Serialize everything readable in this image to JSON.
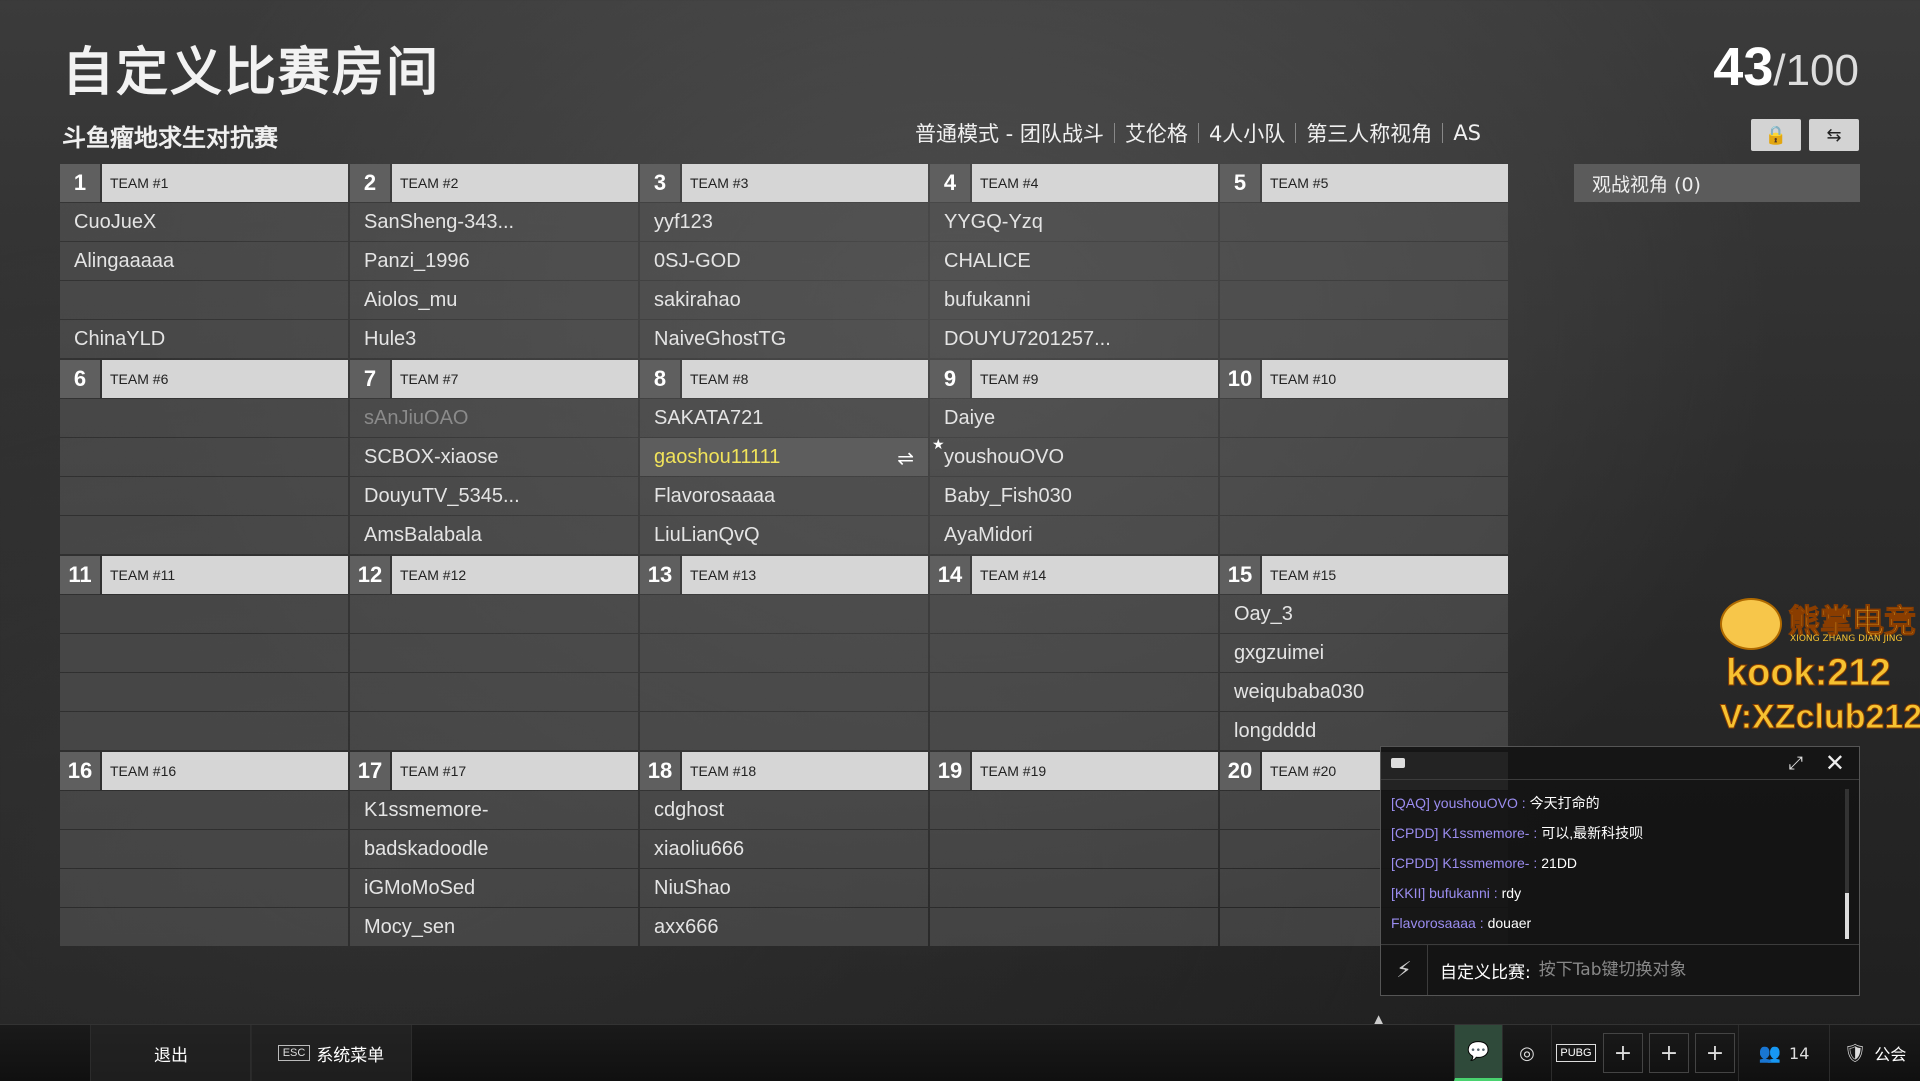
{
  "header": {
    "title": "自定义比赛房间",
    "player_count": "43",
    "player_total": "/100",
    "subtitle": "斗鱼瘤地求生对抗赛",
    "modes": [
      "普通模式 - 团队战斗",
      "艾伦格",
      "4人小队",
      "第三人称视角",
      "AS"
    ],
    "observer": "观战视角 (0)"
  },
  "teams": [
    {
      "num": "1",
      "name": "TEAM #1",
      "players": [
        "CuoJueX",
        "Alingaaaaa",
        "",
        "ChinaYLD"
      ]
    },
    {
      "num": "2",
      "name": "TEAM #2",
      "players": [
        "SanSheng-343...",
        "Panzi_1996",
        "Aiolos_mu",
        "Hule3"
      ]
    },
    {
      "num": "3",
      "name": "TEAM #3",
      "players": [
        "yyf123",
        "0SJ-GOD",
        "sakirahao",
        "NaiveGhostTG"
      ]
    },
    {
      "num": "4",
      "name": "TEAM #4",
      "players": [
        "YYGQ-Yzq",
        "CHALICE",
        "bufukanni",
        "DOUYU7201257..."
      ]
    },
    {
      "num": "5",
      "name": "TEAM #5",
      "players": [
        "",
        "",
        "",
        ""
      ]
    },
    {
      "num": "6",
      "name": "TEAM #6",
      "players": [
        "",
        "",
        "",
        ""
      ]
    },
    {
      "num": "7",
      "name": "TEAM #7",
      "players": [
        "sAnJiuOAO",
        "SCBOX-xiaose",
        "DouyuTV_5345...",
        "AmsBalabala"
      ]
    },
    {
      "num": "8",
      "name": "TEAM #8",
      "players": [
        "SAKATA721",
        "gaoshou11111",
        "Flavorosaaaa",
        "LiuLianQvQ"
      ]
    },
    {
      "num": "9",
      "name": "TEAM #9",
      "players": [
        "Daiye",
        "youshouOVO",
        "Baby_Fish030",
        "AyaMidori"
      ]
    },
    {
      "num": "10",
      "name": "TEAM #10",
      "players": [
        "",
        "",
        "",
        ""
      ]
    },
    {
      "num": "11",
      "name": "TEAM #11",
      "players": [
        "",
        "",
        "",
        ""
      ]
    },
    {
      "num": "12",
      "name": "TEAM #12",
      "players": [
        "",
        "",
        "",
        ""
      ]
    },
    {
      "num": "13",
      "name": "TEAM #13",
      "players": [
        "",
        "",
        "",
        ""
      ]
    },
    {
      "num": "14",
      "name": "TEAM #14",
      "players": [
        "",
        "",
        "",
        ""
      ]
    },
    {
      "num": "15",
      "name": "TEAM #15",
      "players": [
        "Oay_3",
        "gxgzuimei",
        "weiqubaba030",
        "longdddd"
      ]
    },
    {
      "num": "16",
      "name": "TEAM #16",
      "players": [
        "",
        "",
        "",
        ""
      ]
    },
    {
      "num": "17",
      "name": "TEAM #17",
      "players": [
        "K1ssmemore-",
        "badskadoodle",
        "iGMoMoSed",
        "Mocy_sen"
      ]
    },
    {
      "num": "18",
      "name": "TEAM #18",
      "players": [
        "cdghost",
        "xiaoliu666",
        "NiuShao",
        "axx666"
      ]
    },
    {
      "num": "19",
      "name": "TEAM #19",
      "players": [
        "",
        "",
        "",
        ""
      ]
    },
    {
      "num": "20",
      "name": "TEAM #20",
      "players": [
        "",
        "",
        "",
        ""
      ]
    }
  ],
  "watermark": {
    "brand": "熊掌电竞",
    "brand_sub": "XIONG ZHANG DIAN JING",
    "line1": "kook:212",
    "line2": "V:XZclub212"
  },
  "chat": {
    "messages": [
      {
        "who": "[QAQ] youshouOVO :",
        "text": "今天打命的"
      },
      {
        "who": "[CPDD] K1ssmemore- :",
        "text": "可以,最新科技呗"
      },
      {
        "who": "[CPDD] K1ssmemore- :",
        "text": "21DD"
      },
      {
        "who": "[KKII] bufukanni :",
        "text": "rdy"
      },
      {
        "who": "Flavorosaaaa :",
        "text": "douaer"
      }
    ],
    "input_label": "自定义比赛:",
    "input_placeholder": "按下Tab键切换对象"
  },
  "bottombar": {
    "exit": "退出",
    "esc_key": "ESC",
    "system_menu": "系统菜单",
    "pubg": "PUBG",
    "friends_count": "14",
    "guild": "公会"
  },
  "colors": {
    "highlight_player": "#f1e35a",
    "chat_name": "#9b8df0",
    "watermark": "#f6c231"
  }
}
